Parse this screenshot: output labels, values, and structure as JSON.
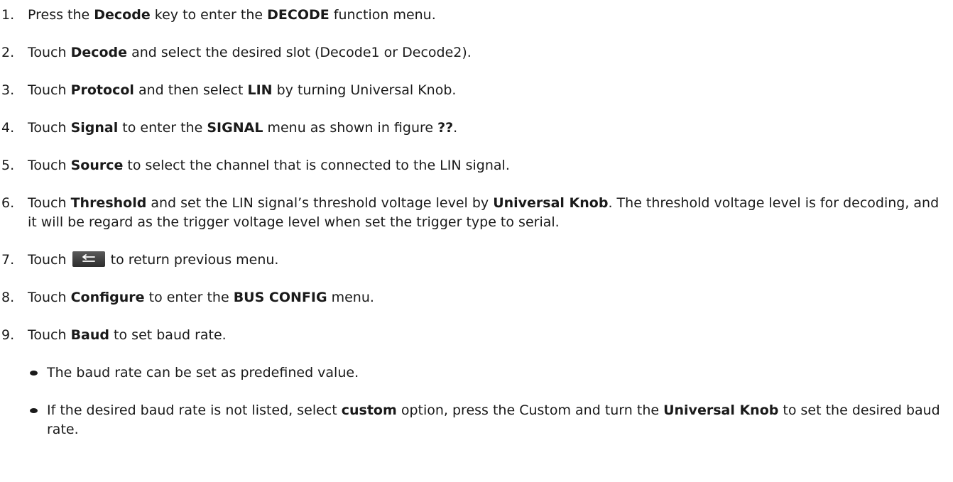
{
  "steps": [
    {
      "num": "1.",
      "t1": "Press the ",
      "b1": "Decode",
      "t2": " key to enter the ",
      "b2": "DECODE",
      "t3": " function menu."
    },
    {
      "num": "2.",
      "t1": "Touch ",
      "b1": "Decode",
      "t2": " and select the desired slot (Decode1 or Decode2)."
    },
    {
      "num": "3.",
      "t1": "Touch ",
      "b1": "Protocol",
      "t2": " and then select ",
      "b2": "LIN",
      "t3": " by turning Universal Knob."
    },
    {
      "num": "4.",
      "t1": "Touch ",
      "b1": "Signal",
      "t2": " to enter the ",
      "b2": "SIGNAL",
      "t3": " menu as shown in figure ",
      "b3": "??",
      "t4": "."
    },
    {
      "num": "5.",
      "t1": "Touch ",
      "b1": "Source",
      "t2": " to select the channel that is connected to the LIN signal."
    },
    {
      "num": "6.",
      "t1": "Touch ",
      "b1": "Threshold",
      "t2": " and set the LIN signal’s threshold voltage level by ",
      "b2": "Universal Knob",
      "t3": ".  The threshold voltage level is for decoding, and it will be regard as the trigger voltage level when set the trigger type to serial."
    },
    {
      "num": "7.",
      "t1": "Touch ",
      "t2": " to return previous menu.",
      "icon": "return-arrow-icon"
    },
    {
      "num": "8.",
      "t1": "Touch ",
      "b1": "Configure",
      "t2": " to enter the ",
      "b2": "BUS CONFIG",
      "t3": " menu."
    },
    {
      "num": "9.",
      "t1": "Touch ",
      "b1": "Baud",
      "t2": " to set baud rate."
    }
  ],
  "sub_bullets": [
    {
      "t1": "The baud rate can be set as predefined value."
    },
    {
      "t1": "If the desired baud rate is not listed, select ",
      "b1": "custom",
      "t2": " option, press the Custom and turn the ",
      "b2": "Universal Knob",
      "t3": " to set the desired baud rate."
    }
  ],
  "colors": {
    "text": "#1a1a1a",
    "button": "#3a3a3a"
  }
}
